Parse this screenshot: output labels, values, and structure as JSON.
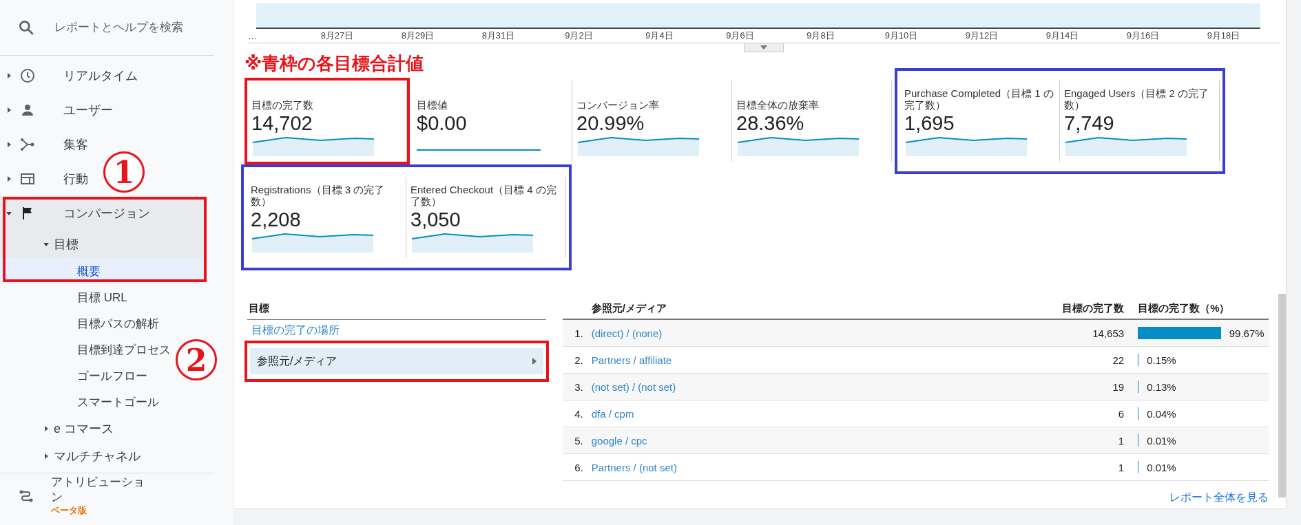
{
  "sidebar": {
    "search": {
      "placeholder": "レポートとヘルプを検索"
    },
    "items": [
      {
        "label": "リアルタイム",
        "expanded": false,
        "selected": false
      },
      {
        "label": "ユーザー",
        "expanded": false,
        "selected": false
      },
      {
        "label": "集客",
        "expanded": false,
        "selected": false
      },
      {
        "label": "行動",
        "expanded": false,
        "selected": false
      },
      {
        "label": "コンバージョン",
        "expanded": true,
        "selected": false,
        "children": [
          {
            "label": "目標",
            "expanded": true,
            "selected": false,
            "children": [
              {
                "label": "概要",
                "selected": true
              },
              {
                "label": "目標 URL",
                "selected": false
              },
              {
                "label": "目標パスの解析",
                "selected": false
              },
              {
                "label": "目標到達プロセス",
                "selected": false
              },
              {
                "label": "ゴールフロー",
                "selected": false
              },
              {
                "label": "スマートゴール",
                "selected": false
              }
            ]
          },
          {
            "label": "e コマース",
            "expanded": false,
            "selected": false
          },
          {
            "label": "マルチチャネル",
            "expanded": false,
            "selected": false
          }
        ]
      }
    ],
    "footer_item": {
      "label": "アトリビューション",
      "badge": "ベータ版"
    }
  },
  "callouts": [
    {
      "label": "1"
    },
    {
      "label": "2"
    }
  ],
  "timeline": {
    "x_labels": [
      "…",
      "8月27日",
      "8月29日",
      "8月31日",
      "9月2日",
      "9月4日",
      "9月6日",
      "9月8日",
      "9月10日",
      "9月12日",
      "9月14日",
      "9月16日",
      "9月18日"
    ]
  },
  "annotation": "※青枠の各目標合計値",
  "metric_rows": [
    {
      "groups": [
        {
          "color": "#e8141c",
          "metrics": [
            {
              "label": "目標の完了数",
              "value": "14,702",
              "kind": "trend"
            }
          ]
        },
        {
          "metrics": [
            {
              "label": "目標値",
              "value": "$0.00",
              "kind": "flat"
            },
            {
              "label": "コンバージョン率",
              "value": "20.99%",
              "kind": "trend"
            },
            {
              "label": "目標全体の放棄率",
              "value": "28.36%",
              "kind": "trend"
            }
          ]
        },
        {
          "color": "#3b3fcf",
          "metrics": [
            {
              "label": "Purchase Completed（目標 1 の完了数）",
              "value": "1,695",
              "kind": "trend"
            },
            {
              "label": "Engaged Users（目標 2 の完了数）",
              "value": "7,749",
              "kind": "trend"
            }
          ]
        }
      ]
    },
    {
      "groups": [
        {
          "color": "#3b3fcf",
          "metrics": [
            {
              "label": "Registrations（目標 3 の完了数）",
              "value": "2,208",
              "kind": "trend"
            },
            {
              "label": "Entered Checkout（目標 4 の完了数）",
              "value": "3,050",
              "kind": "trend"
            }
          ]
        }
      ]
    }
  ],
  "dimensions": {
    "title": "目標",
    "items": [
      {
        "label": "目標の完了の場所",
        "selected": false
      },
      {
        "label": "参照元/メディア",
        "selected": true,
        "color": "#e8141c"
      }
    ]
  },
  "table": {
    "columns": [
      "参照元/メディア",
      "目標の完了数",
      "目標の完了数（%）"
    ],
    "rows": [
      {
        "index": "1.",
        "source": "(direct) / (none)",
        "count": "14,653",
        "percent": "99.67%"
      },
      {
        "index": "2.",
        "source": "Partners / affiliate",
        "count": "22",
        "percent": "0.15%"
      },
      {
        "index": "3.",
        "source": "(not set) / (not set)",
        "count": "19",
        "percent": "0.13%"
      },
      {
        "index": "4.",
        "source": "dfa / cpm",
        "count": "6",
        "percent": "0.04%"
      },
      {
        "index": "5.",
        "source": "google / cpc",
        "count": "1",
        "percent": "0.01%"
      },
      {
        "index": "6.",
        "source": "Partners / (not set)",
        "count": "1",
        "percent": "0.01%"
      }
    ],
    "footer_link": "レポート全体を見る"
  }
}
